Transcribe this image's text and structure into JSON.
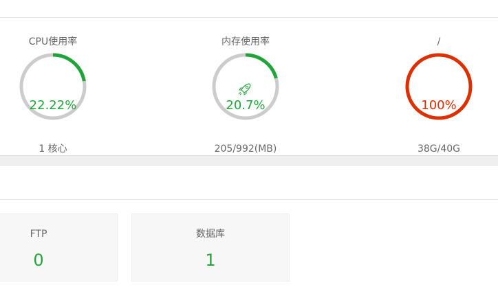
{
  "colors": {
    "green": "#20a53a",
    "red": "#dd2f00",
    "track": "#cccccc"
  },
  "gauges": [
    {
      "title": "CPU使用率",
      "value": "22.22%",
      "sub": "1 核心",
      "percent": 22.22,
      "color": "#20a53a"
    },
    {
      "title": "内存使用率",
      "value": "20.7%",
      "sub": "205/992(MB)",
      "percent": 20.7,
      "color": "#20a53a",
      "icon": "rocket-icon"
    },
    {
      "title": "/",
      "value": "100%",
      "sub": "38G/40G",
      "percent": 100,
      "color": "#dd2f00"
    }
  ],
  "stats": [
    {
      "label": "FTP",
      "count": "0"
    },
    {
      "label": "数据库",
      "count": "1"
    }
  ]
}
